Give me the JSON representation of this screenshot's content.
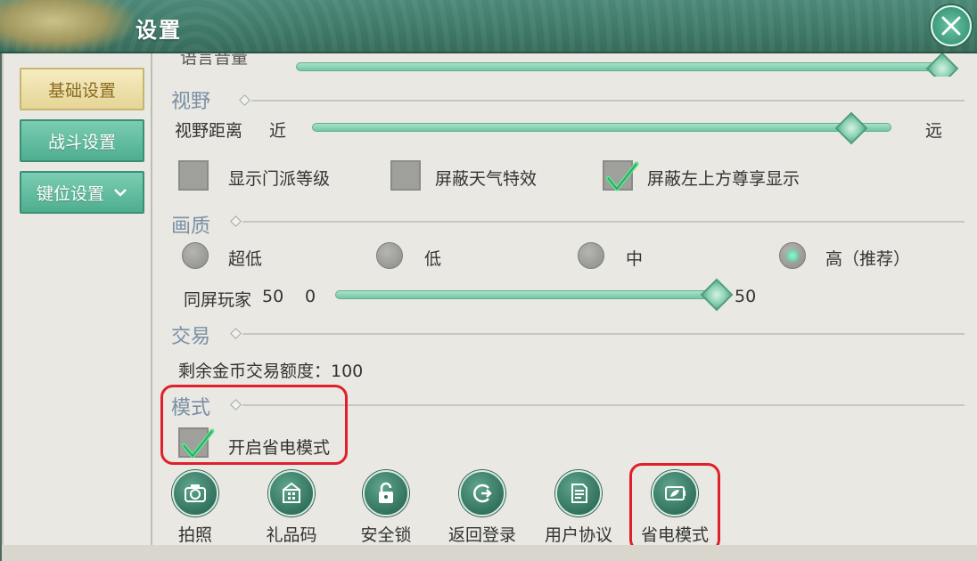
{
  "header": {
    "title": "设置"
  },
  "sidebar": {
    "items": [
      {
        "label": "基础设置",
        "active": true
      },
      {
        "label": "战斗设置",
        "active": false
      },
      {
        "label": "键位设置",
        "active": false,
        "has_dropdown": true
      }
    ]
  },
  "partial_top": {
    "label": "语言音量"
  },
  "vision": {
    "title": "视野",
    "distance_label": "视野距离",
    "near": "近",
    "far": "远",
    "value_fraction": 0.93
  },
  "checkboxes": [
    {
      "label": "显示门派等级",
      "checked": false
    },
    {
      "label": "屏蔽天气特效",
      "checked": false
    },
    {
      "label": "屏蔽左上方尊享显示",
      "checked": true
    }
  ],
  "quality": {
    "title": "画质",
    "options": [
      {
        "label": "超低",
        "selected": false
      },
      {
        "label": "低",
        "selected": false
      },
      {
        "label": "中",
        "selected": false
      },
      {
        "label": "高（推荐）",
        "selected": true
      }
    ],
    "players_label": "同屏玩家",
    "players_value": "50",
    "min": "0",
    "max": "50",
    "value_fraction": 1.0
  },
  "trade": {
    "title": "交易",
    "remaining": "剩余金币交易额度：100"
  },
  "mode": {
    "title": "模式",
    "power_saving_label": "开启省电模式",
    "power_saving_checked": true
  },
  "tools": [
    {
      "label": "拍照",
      "icon": "camera-icon"
    },
    {
      "label": "礼品码",
      "icon": "gift-icon"
    },
    {
      "label": "安全锁",
      "icon": "lock-icon"
    },
    {
      "label": "返回登录",
      "icon": "return-login-icon"
    },
    {
      "label": "用户协议",
      "icon": "agreement-icon"
    },
    {
      "label": "省电模式",
      "icon": "power-saving-icon"
    }
  ],
  "colors": {
    "accent": "#4fae8f",
    "highlight": "#e0202a",
    "section_title": "#7a8fa6"
  }
}
